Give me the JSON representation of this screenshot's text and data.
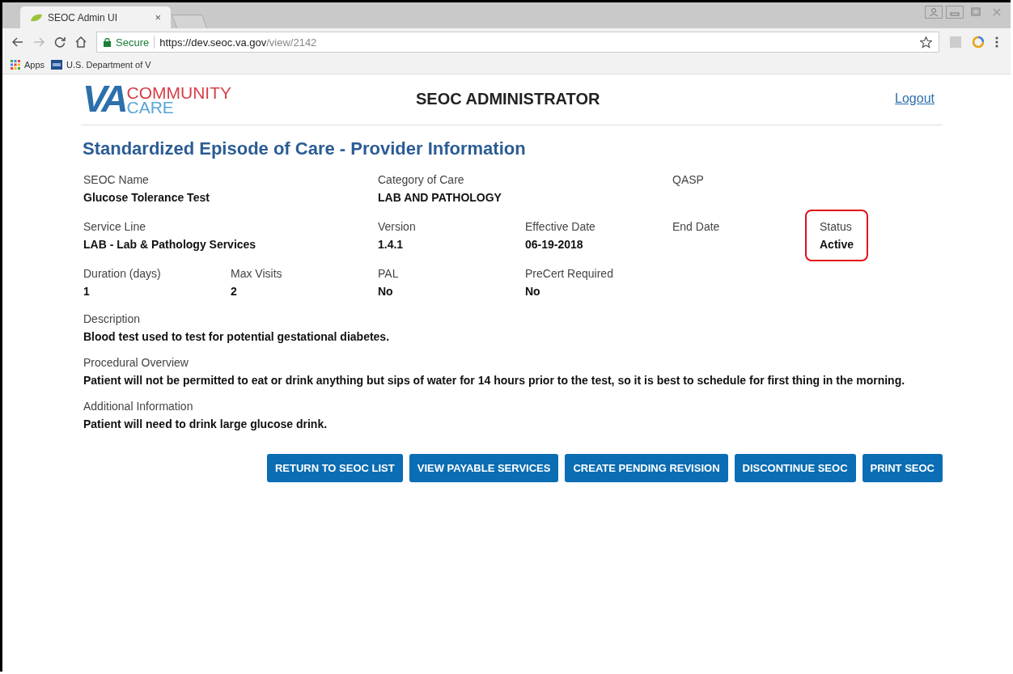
{
  "browser": {
    "tab_title": "SEOC Admin UI",
    "tab_close": "×",
    "secure_label": "Secure",
    "url_host": "https://dev.seoc.va.gov",
    "url_path": "/view/2142",
    "bookmarks": [
      {
        "label": "Apps",
        "kind": "apps"
      },
      {
        "label": "U.S. Department of V",
        "kind": "va"
      }
    ]
  },
  "header": {
    "logo": {
      "mark": "VA",
      "line1": "COMMUNITY",
      "line2": "CARE"
    },
    "title": "SEOC ADMINISTRATOR",
    "logout": "Logout"
  },
  "page_title": "Standardized Episode of Care - Provider Information",
  "field_rows": [
    [
      {
        "label": "SEOC Name",
        "value": "Glucose Tolerance Test",
        "highlighted": false
      },
      {
        "label": "Category of Care",
        "value": "LAB AND PATHOLOGY",
        "highlighted": false
      },
      {
        "label": "QASP",
        "highlighted": false
      }
    ],
    [
      {
        "label": "Service Line",
        "value": "LAB - Lab & Pathology Services",
        "highlighted": false
      },
      {
        "label": "Version",
        "value": "1.4.1",
        "highlighted": false
      },
      {
        "label": "Effective Date",
        "value": "06-19-2018",
        "highlighted": false
      },
      {
        "label": "End Date",
        "highlighted": false
      },
      {
        "label": "Status",
        "value": "Active",
        "highlighted": true
      }
    ],
    [
      {
        "label": "Duration (days)",
        "value": "1",
        "highlighted": false
      },
      {
        "label": "Max Visits",
        "value": "2",
        "highlighted": false
      },
      {
        "label": "PAL",
        "value": "No",
        "highlighted": false
      },
      {
        "label": "PreCert Required",
        "value": "No",
        "highlighted": false
      }
    ]
  ],
  "sections": [
    {
      "label": "Description",
      "value": "Blood test used to test for potential gestational diabetes."
    },
    {
      "label": "Procedural Overview",
      "value": "Patient will not be permitted to eat or drink anything but sips of water for 14 hours prior to the test, so it is best to schedule for first thing in the morning."
    },
    {
      "label": "Additional Information",
      "value": "Patient will need to drink large glucose drink."
    }
  ],
  "buttons": [
    "RETURN TO SEOC LIST",
    "VIEW PAYABLE SERVICES",
    "CREATE PENDING REVISION",
    "DISCONTINUE SEOC",
    "PRINT SEOC"
  ]
}
